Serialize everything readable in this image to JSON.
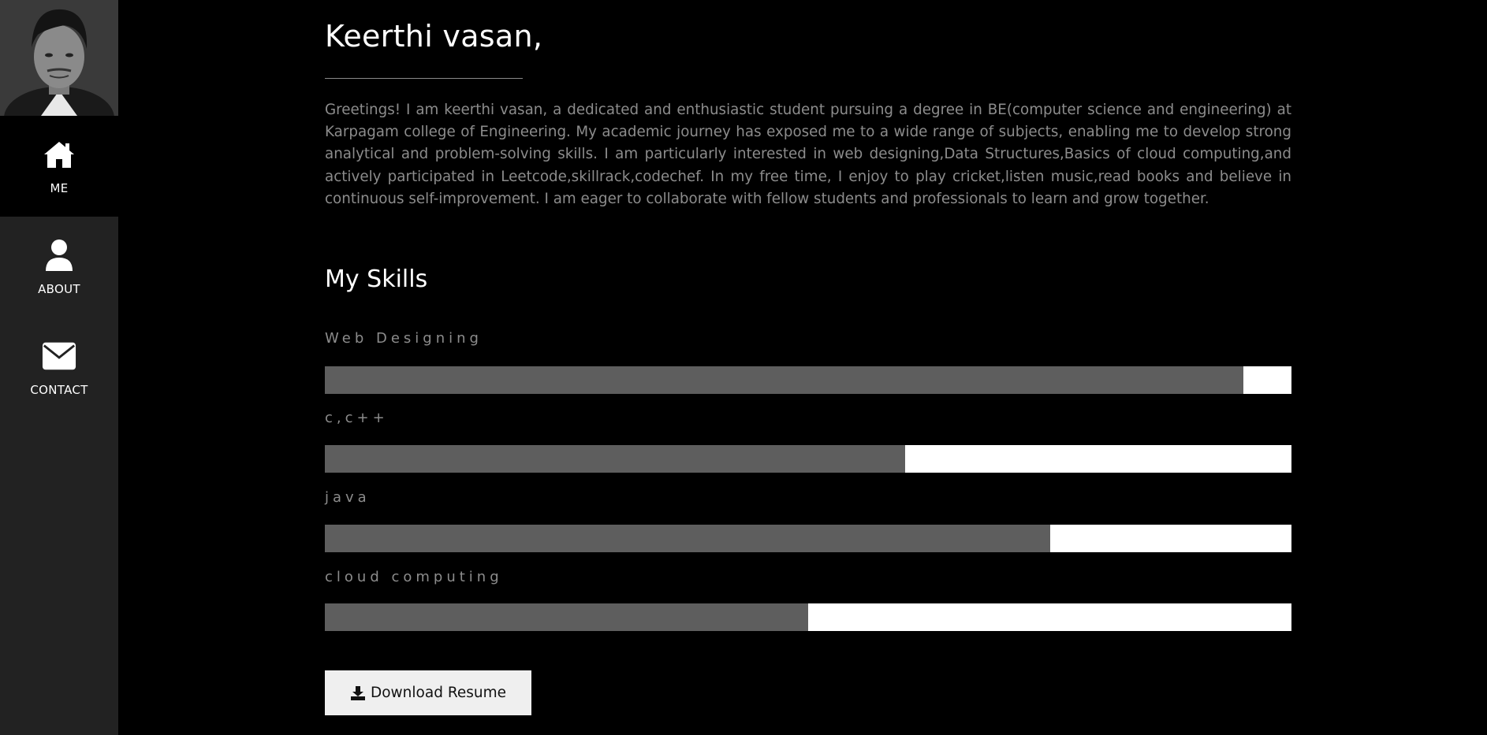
{
  "sidebar": {
    "nav": [
      {
        "label": "ME",
        "icon": "home-icon",
        "active": true
      },
      {
        "label": "ABOUT",
        "icon": "user-icon",
        "active": false
      },
      {
        "label": "CONTACT",
        "icon": "envelope-icon",
        "active": false
      }
    ]
  },
  "main": {
    "name": "Keerthi vasan,",
    "bio": "Greetings! I am keerthi vasan, a dedicated and enthusiastic student pursuing a degree in BE(computer science and engineering) at Karpagam college of Engineering. My academic journey has exposed me to a wide range of subjects, enabling me to develop strong analytical and problem-solving skills. I am particularly interested in web designing,Data Structures,Basics of cloud computing,and actively participated in Leetcode,skillrack,codechef. In my free time, I enjoy to play cricket,listen music,read books and believe in continuous self-improvement. I am eager to collaborate with fellow students and professionals to learn and grow together.",
    "skills_title": "My Skills",
    "skills": [
      {
        "label": "Web Designing",
        "percent": 95
      },
      {
        "label": "c,c++",
        "percent": 60
      },
      {
        "label": "java",
        "percent": 75
      },
      {
        "label": "cloud computing",
        "percent": 50
      }
    ],
    "download_label": "Download Resume"
  },
  "colors": {
    "background": "#000000",
    "sidebar": "#222222",
    "bar_fill": "#5e5e5e",
    "bar_track": "#ffffff",
    "muted_text": "#8c8c8c"
  }
}
